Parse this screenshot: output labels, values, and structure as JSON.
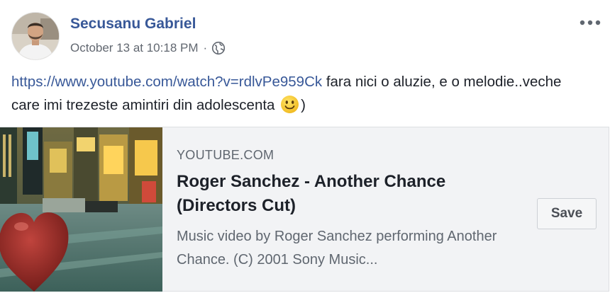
{
  "post": {
    "author": "Secusanu Gabriel",
    "timestamp": "October 13 at 10:18 PM",
    "separator": "·",
    "privacy_icon": "globe-icon",
    "more_icon": "ellipsis-icon",
    "text": {
      "link": "https://www.youtube.com/watch?v=rdlvPe959Ck",
      "body": " fara nici o aluzie, e o melodie..veche care imi trezeste amintiri din adolescenta ",
      "emoji": "smiley-face",
      "closing": ")"
    }
  },
  "link_card": {
    "domain": "YOUTUBE.COM",
    "title": "Roger Sanchez - Another Chance (Directors Cut)",
    "description": "Music video by Roger Sanchez performing Another Chance. (C) 2001 Sony Music...",
    "save_label": "Save",
    "thumbnail": "music-video-thumbnail"
  },
  "colors": {
    "link_blue": "#385898",
    "text": "#1d2129",
    "meta_gray": "#616770",
    "card_bg": "#f2f3f5"
  }
}
